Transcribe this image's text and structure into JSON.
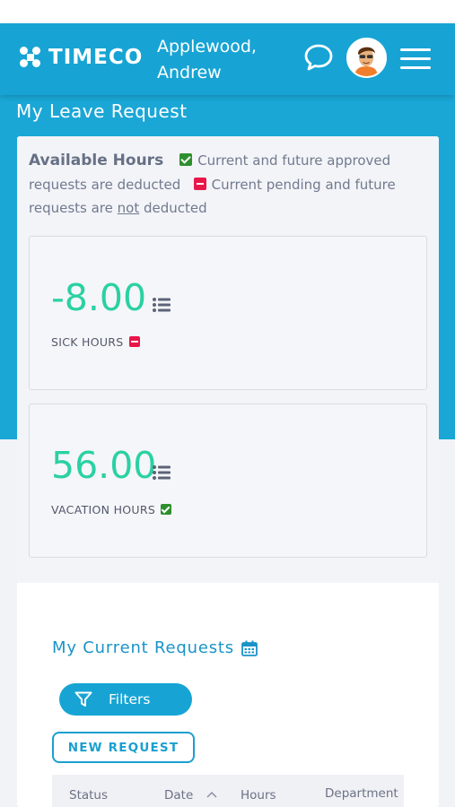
{
  "header": {
    "logo_text": "TIMECO",
    "user_name": "Applewood, Andrew",
    "icons": [
      "chat-icon",
      "avatar",
      "hamburger-menu-icon"
    ]
  },
  "page": {
    "title": "My Leave Request"
  },
  "available_hours": {
    "heading": "Available Hours",
    "approved_text": "Current and future approved requests are deducted",
    "pending_text_pre": "Current pending and future requests are ",
    "pending_text_not": "not",
    "pending_text_post": " deducted",
    "sick": {
      "value": "-8.00",
      "label": "SICK HOURS",
      "status": "pending"
    },
    "vacation": {
      "value": "56.00",
      "label": "VACATION HOURS",
      "status": "approved"
    }
  },
  "requests": {
    "title": "My Current Requests",
    "filters_label": "Filters",
    "new_request_label": "NEW REQUEST",
    "columns": [
      "Status",
      "Date",
      "Hours",
      "Department"
    ]
  },
  "colors": {
    "brand_blue": "#17a4d4",
    "value_green": "#2ad1a3",
    "approved_green": "#2d8f2d",
    "pending_red": "#e8174a"
  }
}
